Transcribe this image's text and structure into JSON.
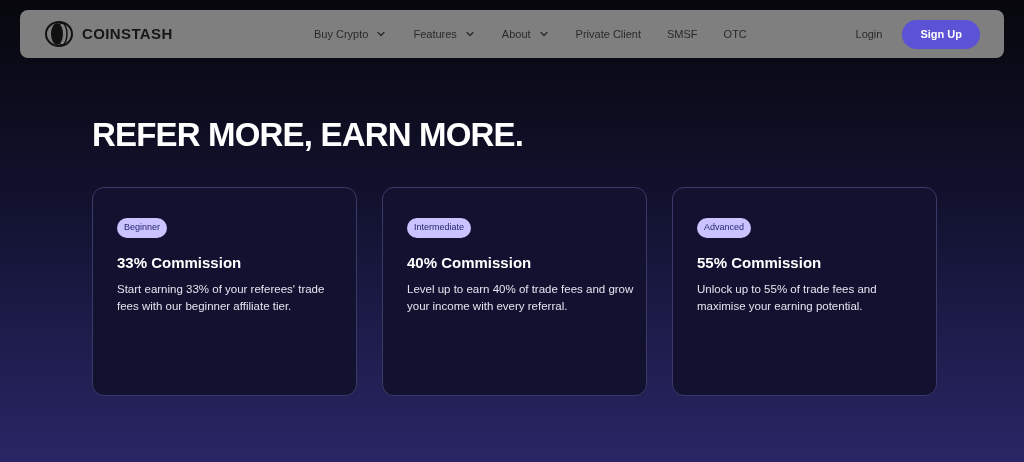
{
  "brand": {
    "name": "COINSTASH"
  },
  "nav": [
    {
      "label": "Buy Crypto",
      "has_menu": true
    },
    {
      "label": "Features",
      "has_menu": true
    },
    {
      "label": "About",
      "has_menu": true
    },
    {
      "label": "Private Client",
      "has_menu": false
    },
    {
      "label": "SMSF",
      "has_menu": false
    },
    {
      "label": "OTC",
      "has_menu": false
    }
  ],
  "login": "Login",
  "signup": "Sign Up",
  "heading": "REFER MORE, EARN MORE.",
  "tiers": [
    {
      "badge": "Beginner",
      "title": "33% Commission",
      "text": "Start earning 33% of your referees' trade fees with our beginner affiliate tier."
    },
    {
      "badge": "Intermediate",
      "title": "40% Commission",
      "text": "Level up to earn 40% of trade fees and grow your income with every referral."
    },
    {
      "badge": "Advanced",
      "title": "55% Commission",
      "text": "Unlock up to 55% of trade fees and maximise your earning potential."
    }
  ]
}
